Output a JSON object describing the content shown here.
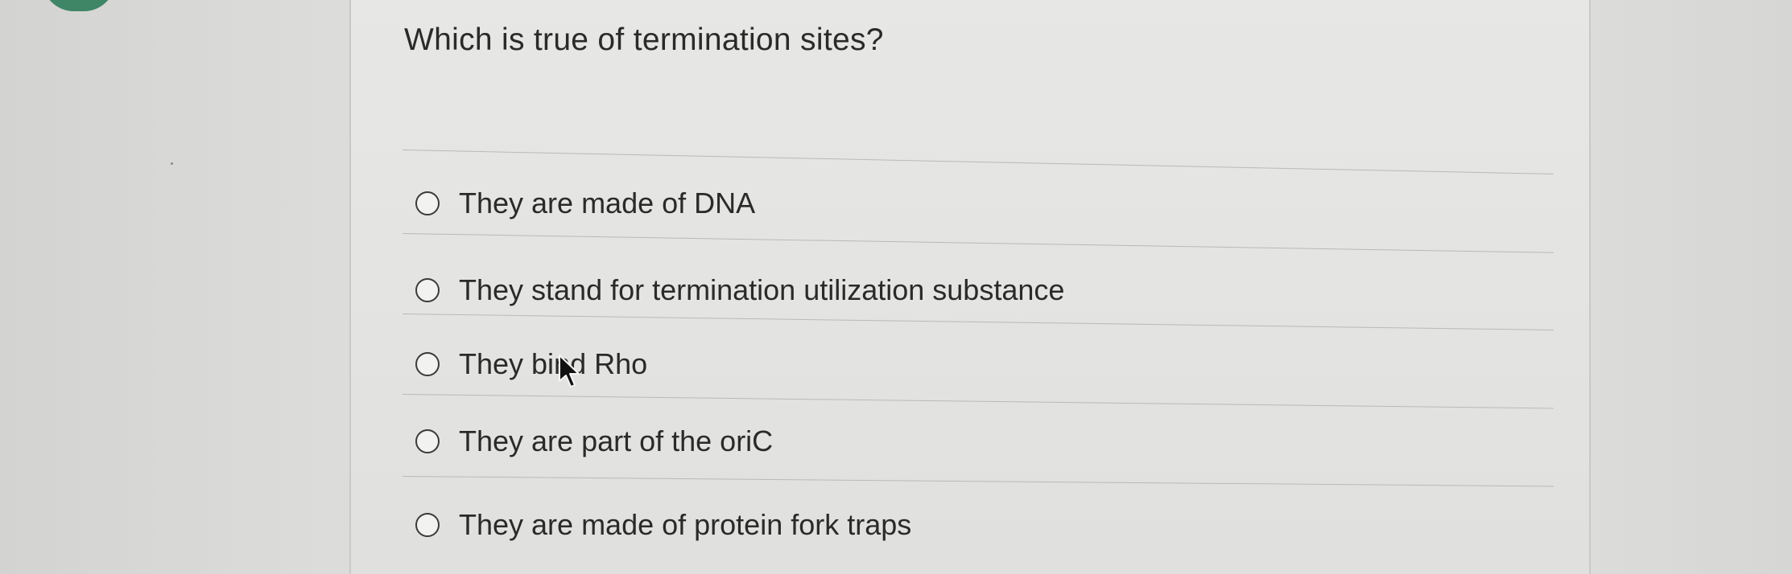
{
  "question": {
    "title": "Which is true of termination sites?"
  },
  "options": [
    {
      "label": "They are made of DNA"
    },
    {
      "label": "They stand for termination utilization substance"
    },
    {
      "label": "They bind Rho"
    },
    {
      "label": "They are part of the oriC"
    },
    {
      "label": "They are made of protein fork traps"
    }
  ],
  "colors": {
    "text": "#2a2a2a",
    "panel": "#e5e5e3",
    "background": "#d9d9d7",
    "rule": "#b9b9b7",
    "accent_blob": "#2f7d5a"
  },
  "icons": {
    "radio": "radio-unchecked-icon",
    "cursor": "mouse-pointer-icon"
  }
}
